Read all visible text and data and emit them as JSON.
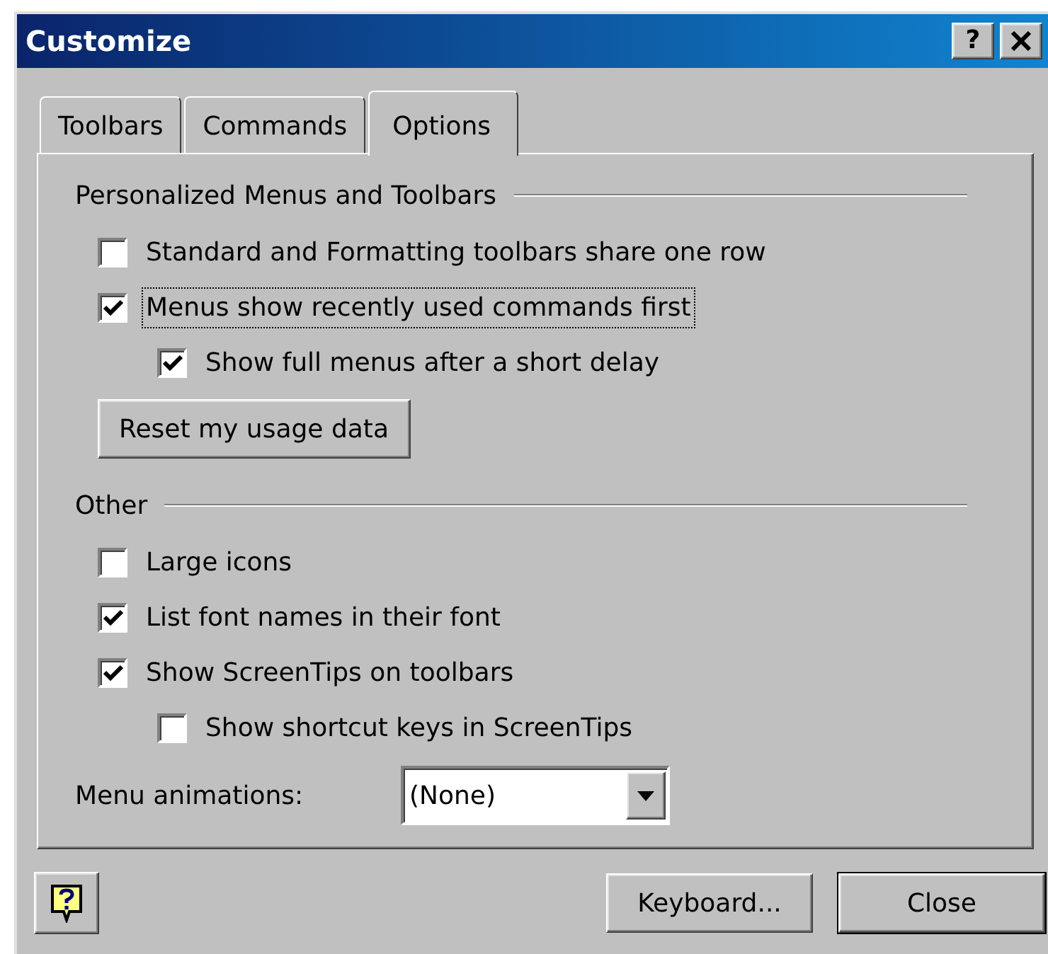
{
  "window": {
    "title": "Customize",
    "help_button": "?"
  },
  "tabs": [
    {
      "label": "Toolbars",
      "selected": false
    },
    {
      "label": "Commands",
      "selected": false
    },
    {
      "label": "Options",
      "selected": true
    }
  ],
  "sections": [
    {
      "title": "Personalized Menus and Toolbars",
      "items": [
        {
          "kind": "checkbox",
          "label": "Standard and Formatting toolbars share one row",
          "checked": false,
          "focused": false
        },
        {
          "kind": "checkbox",
          "label": "Menus show recently used commands first",
          "checked": true,
          "focused": true,
          "children": [
            {
              "kind": "checkbox",
              "label": "Show full menus after a short delay",
              "checked": true,
              "focused": false
            }
          ]
        },
        {
          "kind": "button",
          "label": "Reset my usage data"
        }
      ]
    },
    {
      "title": "Other",
      "items": [
        {
          "kind": "checkbox",
          "label": "Large icons",
          "checked": false,
          "focused": false
        },
        {
          "kind": "checkbox",
          "label": "List font names in their font",
          "checked": true,
          "focused": false
        },
        {
          "kind": "checkbox",
          "label": "Show ScreenTips on toolbars",
          "checked": true,
          "focused": false,
          "children": [
            {
              "kind": "checkbox",
              "label": "Show shortcut keys in ScreenTips",
              "checked": false,
              "focused": false
            }
          ]
        },
        {
          "kind": "dropdown",
          "label": "Menu animations:",
          "value": "(None)"
        }
      ]
    }
  ],
  "footer": {
    "buttons": [
      {
        "label": "Keyboard...",
        "default": false
      },
      {
        "label": "Close",
        "default": true
      }
    ]
  }
}
